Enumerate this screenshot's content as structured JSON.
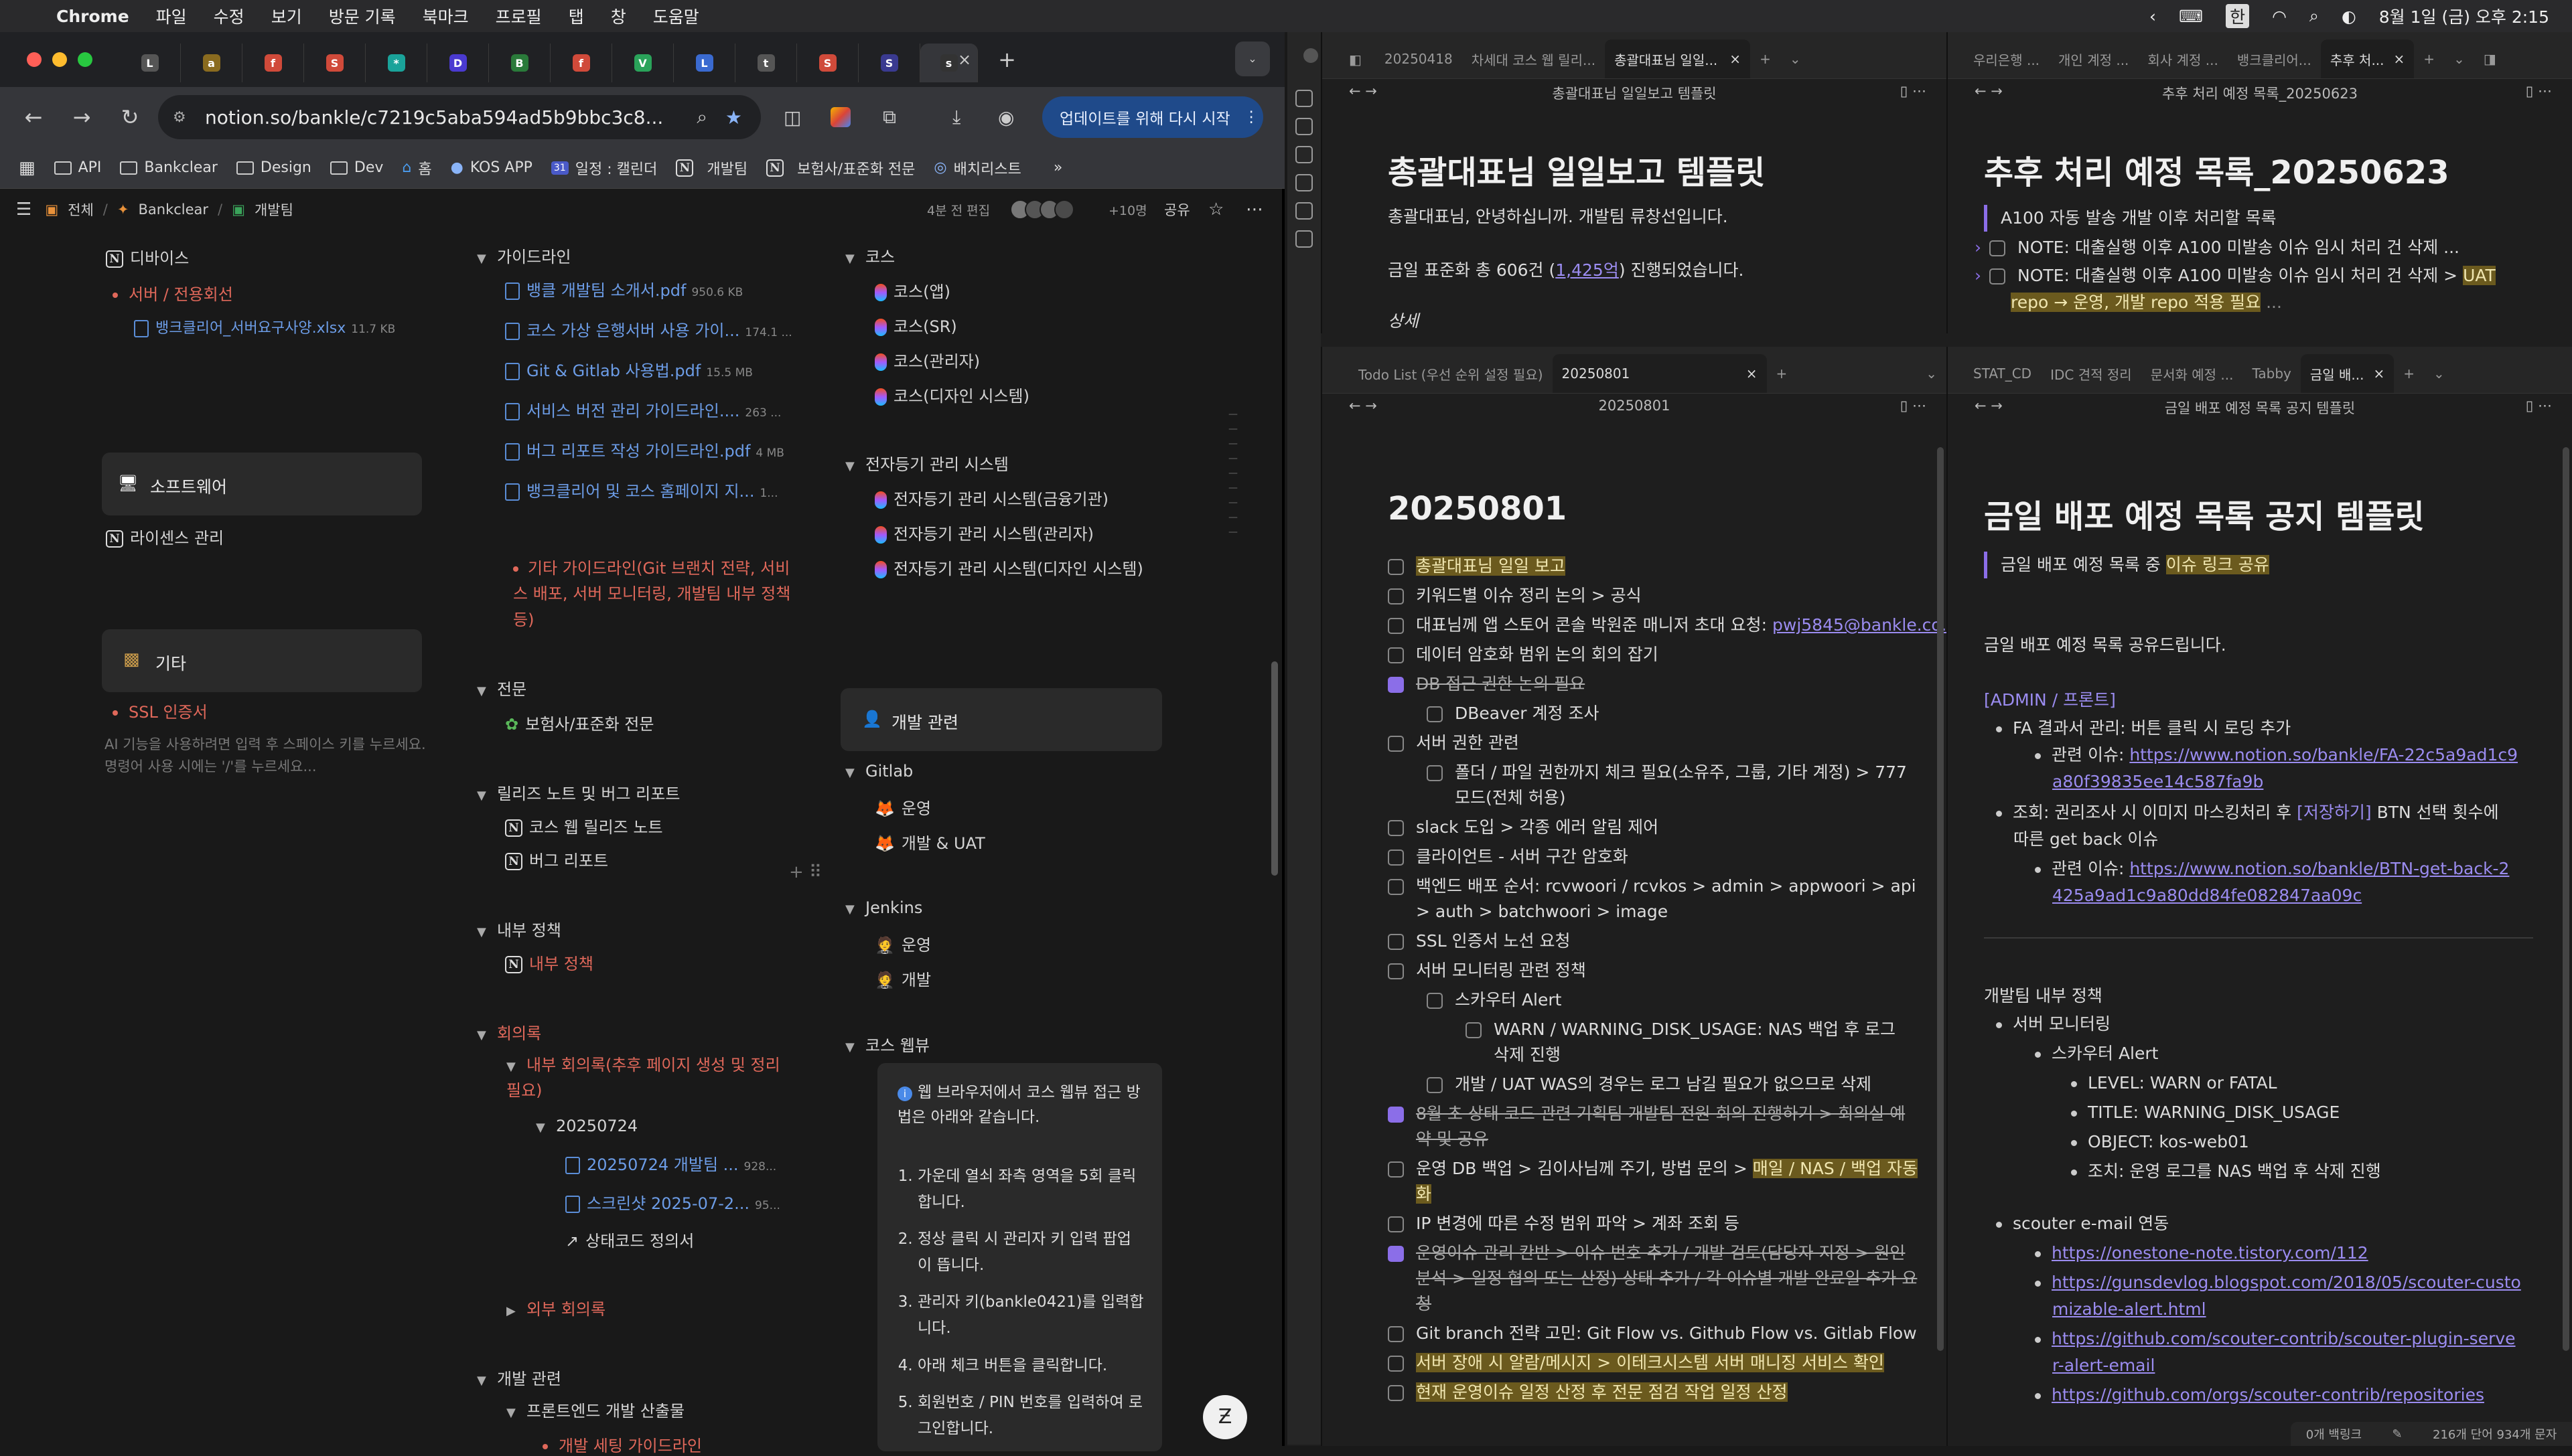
{
  "menubar": {
    "app": "Chrome",
    "items": [
      "파일",
      "수정",
      "보기",
      "방문 기록",
      "북마크",
      "프로필",
      "탭",
      "창",
      "도움말"
    ],
    "datetime": "8월 1일 (금) 오후 2:15"
  },
  "chrome": {
    "tabs": [
      {
        "icon": "L",
        "color": "#555"
      },
      {
        "icon": "a",
        "color": "#8a6b1f"
      },
      {
        "icon": "f",
        "color": "#d04a3a"
      },
      {
        "icon": "S",
        "color": "#d04a3a"
      },
      {
        "icon": "*",
        "color": "#1aa39a"
      },
      {
        "icon": "D",
        "color": "#4a3ad0"
      },
      {
        "icon": "B",
        "color": "#2a7a3a"
      },
      {
        "icon": "f",
        "color": "#d04a3a"
      },
      {
        "icon": "V",
        "color": "#2aa35a"
      },
      {
        "icon": "L",
        "color": "#3a6ad0"
      },
      {
        "icon": "t",
        "color": "#555"
      },
      {
        "icon": "S",
        "color": "#d04a3a"
      },
      {
        "icon": "S",
        "color": "#3a3a90"
      },
      {
        "icon": "s",
        "color": "#333"
      }
    ],
    "url": "notion.so/bankle/c7219c5aba594ad5b9bbc3c8...",
    "update_button": "업데이트를 위해 다시 시작",
    "bookmarks": [
      "API",
      "Bankclear",
      "Design",
      "Dev",
      "홈",
      "KOS APP",
      "일정 : 캘린더",
      "개발팀",
      "보험사/표준화 전문",
      "배치리스트"
    ]
  },
  "notion": {
    "breadcrumb": [
      "전체",
      "Bankclear",
      "개발팀"
    ],
    "edited": "4분 전 편집",
    "people_extra": "+10명",
    "share": "공유",
    "col1": {
      "divice": "디바이스",
      "server_item": "서버 / 전용회선",
      "server_file": "뱅크클리어_서버요구사양.xlsx",
      "server_file_size": "11.7 KB",
      "software": "소프트웨어",
      "license": "라이센스 관리",
      "etc": "기타",
      "ssl": "SSL 인증서",
      "ai_hint": "AI 기능을 사용하려면 입력 후 스페이스 키를 누르세요. 명령어 사용 시에는 '/'를 누르세요..."
    },
    "col2": {
      "guideline": "가이드라인",
      "files": [
        {
          "name": "뱅클 개발팀 소개서.pdf",
          "size": "950.6 KB"
        },
        {
          "name": "코스 가상 은행서버 사용 가이...",
          "size": "174.1 ..."
        },
        {
          "name": "Git & Gitlab 사용법.pdf",
          "size": "15.5 MB"
        },
        {
          "name": "서비스 버전 관리 가이드라인....",
          "size": "263 ..."
        },
        {
          "name": "버그 리포트 작성 가이드라인.pdf",
          "size": "4 MB"
        },
        {
          "name": "뱅크클리어 및 코스 홈페이지 지...",
          "size": "1..."
        }
      ],
      "other_guide": "기타 가이드라인(Git 브랜치 전략, 서비스 배포, 서버 모니터링, 개발팀 내부 정책 등)",
      "expert": "전문",
      "expert_item": "보험사/표준화 전문",
      "release": "릴리즈 노트 및 버그 리포트",
      "release1": "코스 웹 릴리즈 노트",
      "release2": "버그 리포트",
      "policy": "내부 정책",
      "policy_item": "내부 정책",
      "minutes": "회의록",
      "internal_minutes": "내부 회의록(추후 페이지 생성 및 정리 필요)",
      "date": "20250724",
      "f1": "20250724 개발팀 ...",
      "f1size": "928...",
      "f2": "스크린샷 2025-07-2...",
      "f2size": "95...",
      "f3": "상태코드 정의서",
      "external": "외부 회의록",
      "dev": "개발 관련",
      "frontend": "프론트엔드 개발 산출물",
      "dev_setting": "개발 세팅 가이드라인"
    },
    "col3": {
      "kos": "코스",
      "kos_items": [
        "코스(앱)",
        "코스(SR)",
        "코스(관리자)",
        "코스(디자인 시스템)"
      ],
      "edoc": "전자등기 관리 시스템",
      "edoc_items": [
        "전자등기 관리 시스템(금융기관)",
        "전자등기 관리 시스템(관리자)",
        "전자등기 관리 시스템(디자인 시스템)"
      ],
      "devrel": "개발 관련",
      "gitlab": "Gitlab",
      "gitlab_items": [
        "운영",
        "개발 & UAT"
      ],
      "jenkins": "Jenkins",
      "jenkins_items": [
        "운영",
        "개발"
      ],
      "kosweb": "코스 웹뷰",
      "callout": "웹 브라우저에서 코스 웹뷰 접근 방법은 아래와 같습니다.",
      "steps": [
        "가운데 열쇠 좌측 영역을 5회 클릭합니다.",
        "정상 클릭 시 관리자 키 입력 팝업이 뜹니다.",
        "관리자 키(bankle0421)를 입력합니다.",
        "아래 체크 버튼을 클릭합니다.",
        "회원번호 / PIN 번호를 입력하여 로그인합니다."
      ]
    }
  },
  "obsidian": {
    "p1": {
      "tabs": [
        "20250418",
        "차세대 코스 웹 릴리...",
        "총괄대표님 일일..."
      ],
      "nav": "총괄대표님 일일보고 템플릿",
      "title": "총괄대표님 일일보고 템플릿",
      "l1": "총괄대표님, 안녕하십니까. 개발팀 류창선입니다.",
      "l2a": "금일 표준화 총 606건 (",
      "l2b": "1,425억",
      "l2c": ") 진행되었습니다.",
      "l3": "상세"
    },
    "p2": {
      "tabs": [
        "우리은행 ...",
        "개인 계정 ...",
        "회사 계정 ...",
        "뱅크클리어...",
        "추후 처..."
      ],
      "nav": "추후 처리 예정 목록_20250623",
      "title": "추후 처리 예정 목록_20250623",
      "quote": "A100 자동 발송 개발 이후 처리할 목록",
      "i1": "NOTE: 대출실행 이후 A100 미발송 이슈 임시 처리 건 삭제 ...",
      "i2a": "NOTE: 대출실행 이후 A100 미발송 이슈 임시 처리 건 삭제 > ",
      "i2b": "UAT",
      "i2c": "repo → 운영, 개발 repo 적용 필요"
    },
    "p3": {
      "tabs": [
        "Todo List (우선 순위 설정 필요)",
        "20250801"
      ],
      "nav": "20250801",
      "title": "20250801",
      "items": [
        {
          "t": "총괄대표님 일일 보고",
          "c": false,
          "hl": true,
          "s": false,
          "ind": 0
        },
        {
          "t": "키워드별 이슈 정리 논의 > 공식",
          "c": false,
          "hl": false,
          "s": false,
          "ind": 0
        },
        {
          "t": "대표님께 앱 스토어 콘솔 박원준 매니저 초대 요청: ",
          "link": "pwj5845@bankle.co.kr",
          "c": false,
          "hl": false,
          "s": false,
          "ind": 0
        },
        {
          "t": "데이터 암호화 범위 논의 회의 잡기",
          "c": false,
          "hl": false,
          "s": false,
          "ind": 0
        },
        {
          "t": "DB 접근 권한 논의 필요",
          "c": true,
          "hl": false,
          "s": true,
          "ind": 0
        },
        {
          "t": "DBeaver 계정 조사",
          "c": false,
          "hl": false,
          "s": false,
          "ind": 1
        },
        {
          "t": "서버 권한 관련",
          "c": false,
          "hl": false,
          "s": false,
          "ind": 0
        },
        {
          "t": "폴더 / 파일 권한까지 체크 필요(소유주, 그룹, 기타 계정) > 777",
          "t2": "모드(전체 허용)",
          "c": false,
          "hl": false,
          "s": false,
          "ind": 1
        },
        {
          "t": "slack 도입 > 각종 에러 알림 제어",
          "c": false,
          "hl": false,
          "s": false,
          "ind": 0
        },
        {
          "t": "클라이언트 - 서버 구간 암호화",
          "c": false,
          "hl": false,
          "s": false,
          "ind": 0
        },
        {
          "t": "백엔드 배포 순서: rcvwoori / rcvkos > admin > appwoori > api",
          "t2": "> auth > batchwoori > image",
          "c": false,
          "hl": false,
          "s": false,
          "ind": 0
        },
        {
          "t": "SSL 인증서 노선 요청",
          "c": false,
          "hl": false,
          "s": false,
          "ind": 0
        },
        {
          "t": "서버 모니터링 관련 정책",
          "c": false,
          "hl": false,
          "s": false,
          "ind": 0
        },
        {
          "t": "스카우터 Alert",
          "c": false,
          "hl": false,
          "s": false,
          "ind": 1
        },
        {
          "t": "WARN / WARNING_DISK_USAGE: NAS 백업 후 로그",
          "t2": "삭제 진행",
          "c": false,
          "hl": false,
          "s": false,
          "ind": 2
        },
        {
          "t": "개발 / UAT WAS의 경우는 로그 남길 필요가 없으므로 삭제",
          "c": false,
          "hl": false,
          "s": false,
          "ind": 1
        },
        {
          "t": "8월 초 상태 코드 관련 기획팀 개발팀 전원 회의 진행하기 > 회의실 예",
          "t2": "약 및 공유",
          "c": true,
          "hl": false,
          "s": true,
          "ind": 0
        },
        {
          "t": "운영 DB 백업 > 김이사님께 주기, 방법 문의 > ",
          "hlpart": "매일 / NAS / 백업 자동",
          "t2": "화",
          "c": false,
          "hl": false,
          "s": false,
          "ind": 0
        },
        {
          "t": "IP 변경에 따른 수정 범위 파악 > 계좌 조회 등",
          "c": false,
          "hl": false,
          "s": false,
          "ind": 0
        },
        {
          "t": "운영이슈 관리 칸반 > 이슈 번호 추가 / 개발 검토(담당자 지정 > 원인",
          "t2": "분석 > 일정 협의 또는 산정) 상태 추가 / 각 이슈별 개발 완료일 추가 요",
          "t3": "청",
          "c": true,
          "hl": false,
          "s": true,
          "ind": 0
        },
        {
          "t": "Git branch 전략 고민: Git Flow vs. Github Flow vs. Gitlab Flow",
          "c": false,
          "hl": false,
          "s": false,
          "ind": 0
        },
        {
          "t": "서버 장애 시 알람/메시지 > 이테크시스템 서버 매니징 서비스 확인",
          "c": false,
          "hl": true,
          "s": false,
          "ind": 0
        },
        {
          "t": "현재 운영이슈 일정 산정 후 전문 점검 작업 일정 산정",
          "c": false,
          "hl": true,
          "s": false,
          "ind": 0
        }
      ]
    },
    "p4": {
      "tabs": [
        "STAT_CD",
        "IDC 견적 정리",
        "문서화 예정 ...",
        "Tabby",
        "금일 배..."
      ],
      "nav": "금일 배포 예정 목록 공지 템플릿",
      "title": "금일 배포 예정 목록 공지 템플릿",
      "quote_a": "금일 배포 예정 목록 중 ",
      "quote_b": "이슈 링크 공유",
      "l1": "금일 배포 예정 목록 공유드립니다.",
      "admin": "[ADMIN / 프론트]",
      "fa": "FA 결과서 관리: 버튼 클릭 시 로딩 추가",
      "rel": "관련 이슈: ",
      "link1a": "https://www.notion.so/bankle/FA-22c5a9ad1c9",
      "link1b": "a80f39835ee14c587fa9b",
      "jo1": "조회: 권리조사 시 이미지 마스킹처리 후 ",
      "jo1b": "[저장하기]",
      "jo1c": " BTN 선택 횟수에",
      "jo2": "따른 get back 이슈",
      "link2a": "https://www.notion.so/bankle/BTN-get-back-2",
      "link2b": "425a9ad1c9a80dd84fe082847aa09c",
      "policy": "개발팀 내부 정책",
      "mon": "서버 모니터링",
      "scouter": "스카우터 Alert",
      "level": "LEVEL: WARN or FATAL",
      "title2": "TITLE: WARNING_DISK_USAGE",
      "obj": "OBJECT: kos-web01",
      "act": "조치: 운영 로그를 NAS 백업 후 삭제 진행",
      "email": "scouter e-mail 연동",
      "links": [
        "https://onestone-note.tistory.com/112",
        "https://gunsdevlog.blogspot.com/2018/05/scouter-custo",
        "mizable-alert.html",
        "https://github.com/scouter-contrib/scouter-plugin-serve",
        "r-alert-email",
        "https://github.com/orgs/scouter-contrib/repositories"
      ]
    },
    "status": {
      "backlinks": "0개 백링크",
      "words": "216개 단어  934개 문자"
    }
  }
}
